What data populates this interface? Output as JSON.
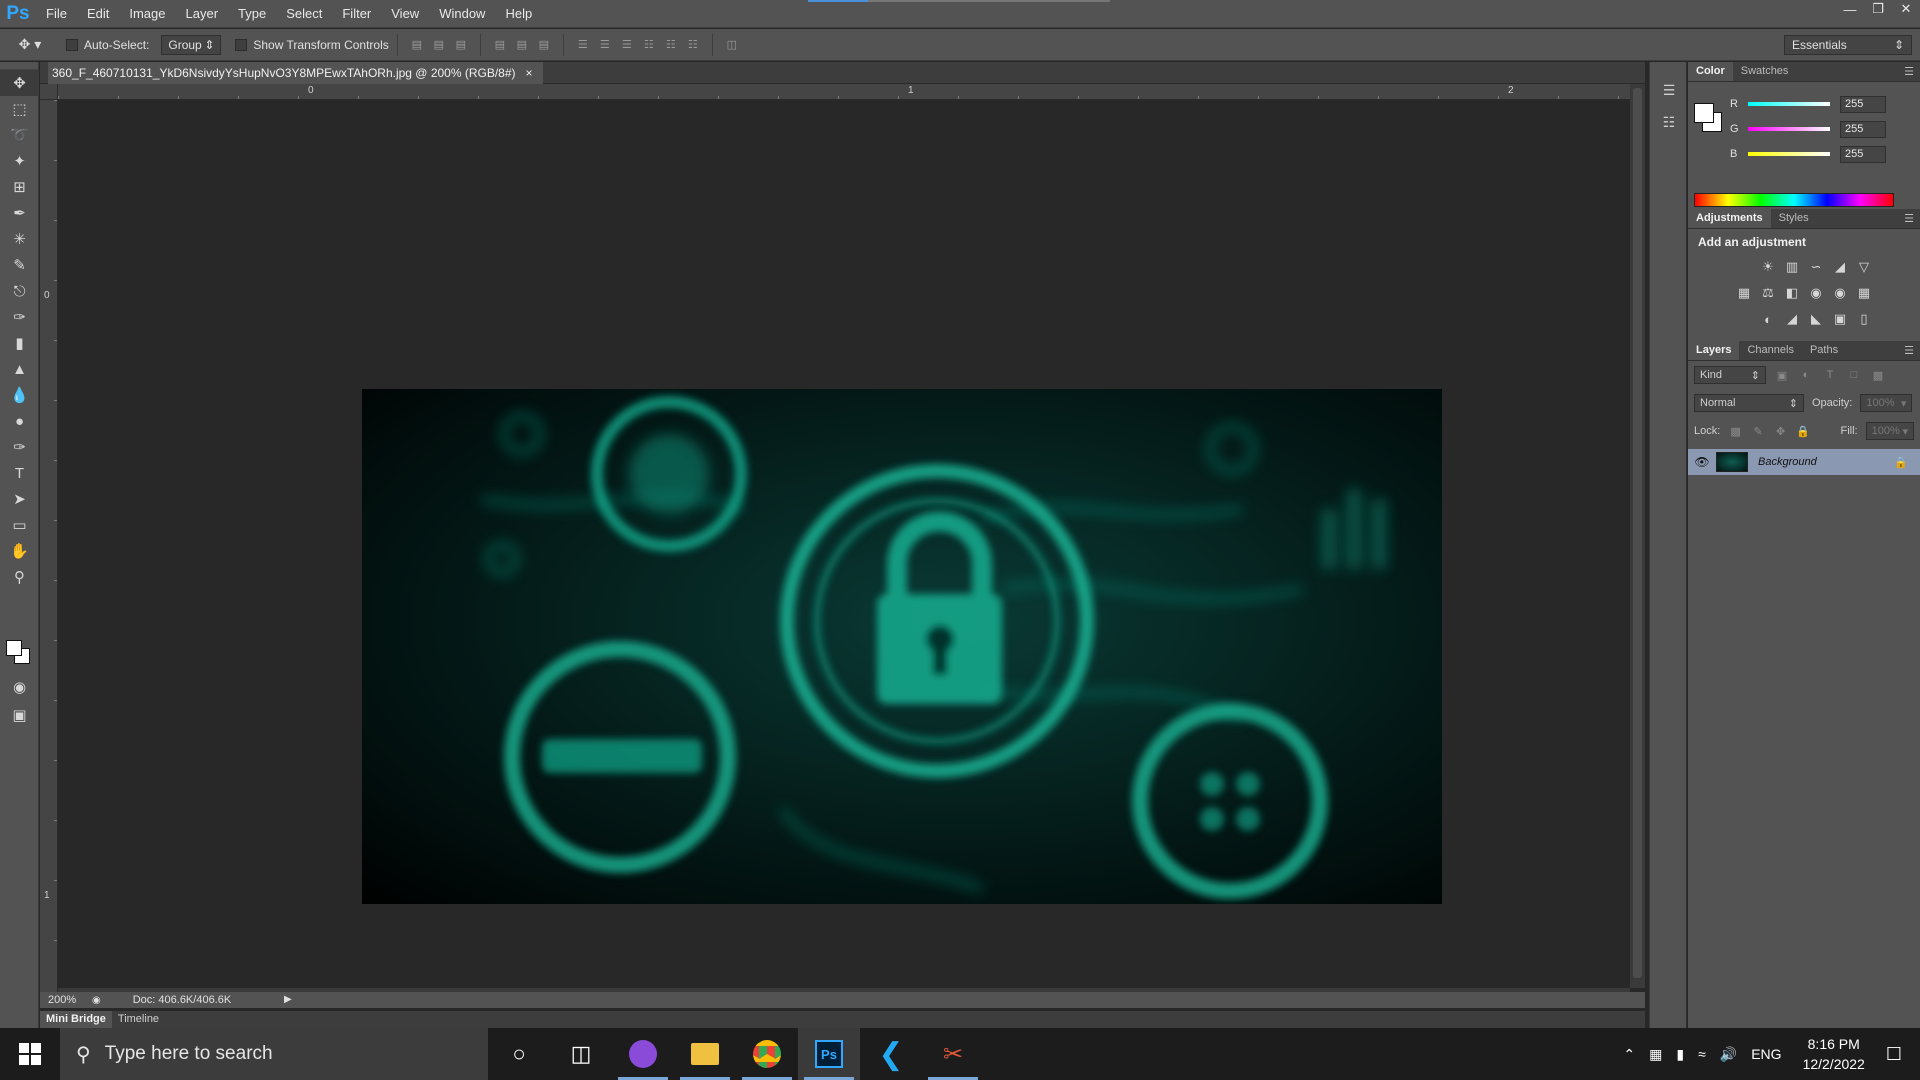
{
  "app": {
    "logo": "Ps",
    "menu": [
      "File",
      "Edit",
      "Image",
      "Layer",
      "Type",
      "Select",
      "Filter",
      "View",
      "Window",
      "Help"
    ]
  },
  "options_bar": {
    "auto_select_label": "Auto-Select:",
    "auto_select_value": "Group",
    "show_transform_label": "Show Transform Controls",
    "workspace": "Essentials"
  },
  "document": {
    "tab_title": "360_F_460710131_YkD6NsivdyYsHupNvO3Y8MPEwxTAhORh.jpg @ 200% (RGB/8#)",
    "ruler_h_labels": [
      "0",
      "1",
      "2"
    ],
    "ruler_v_labels": [
      "0",
      "1"
    ],
    "zoom": "200%",
    "doc_size": "Doc: 406.6K/406.6K"
  },
  "bottom_tabs": [
    "Mini Bridge",
    "Timeline"
  ],
  "color_panel": {
    "tabs": [
      "Color",
      "Swatches"
    ],
    "r_label": "R",
    "r_value": "255",
    "g_label": "G",
    "g_value": "255",
    "b_label": "B",
    "b_value": "255"
  },
  "adjustments_panel": {
    "tabs": [
      "Adjustments",
      "Styles"
    ],
    "title": "Add an adjustment"
  },
  "layers_panel": {
    "tabs": [
      "Layers",
      "Channels",
      "Paths"
    ],
    "kind_filter": "Kind",
    "blend_mode": "Normal",
    "opacity_label": "Opacity:",
    "opacity_value": "100%",
    "lock_label": "Lock:",
    "fill_label": "Fill:",
    "fill_value": "100%",
    "layers": [
      {
        "name": "Background",
        "visible": true,
        "locked": true
      }
    ]
  },
  "taskbar": {
    "search_placeholder": "Type here to search",
    "language": "ENG",
    "time": "8:16 PM",
    "date": "12/2/2022"
  },
  "colors": {
    "ui_panel": "#535353",
    "canvas_bg": "#282828",
    "layer_selected": "#8b98b2",
    "image_glow": "#16b394"
  }
}
